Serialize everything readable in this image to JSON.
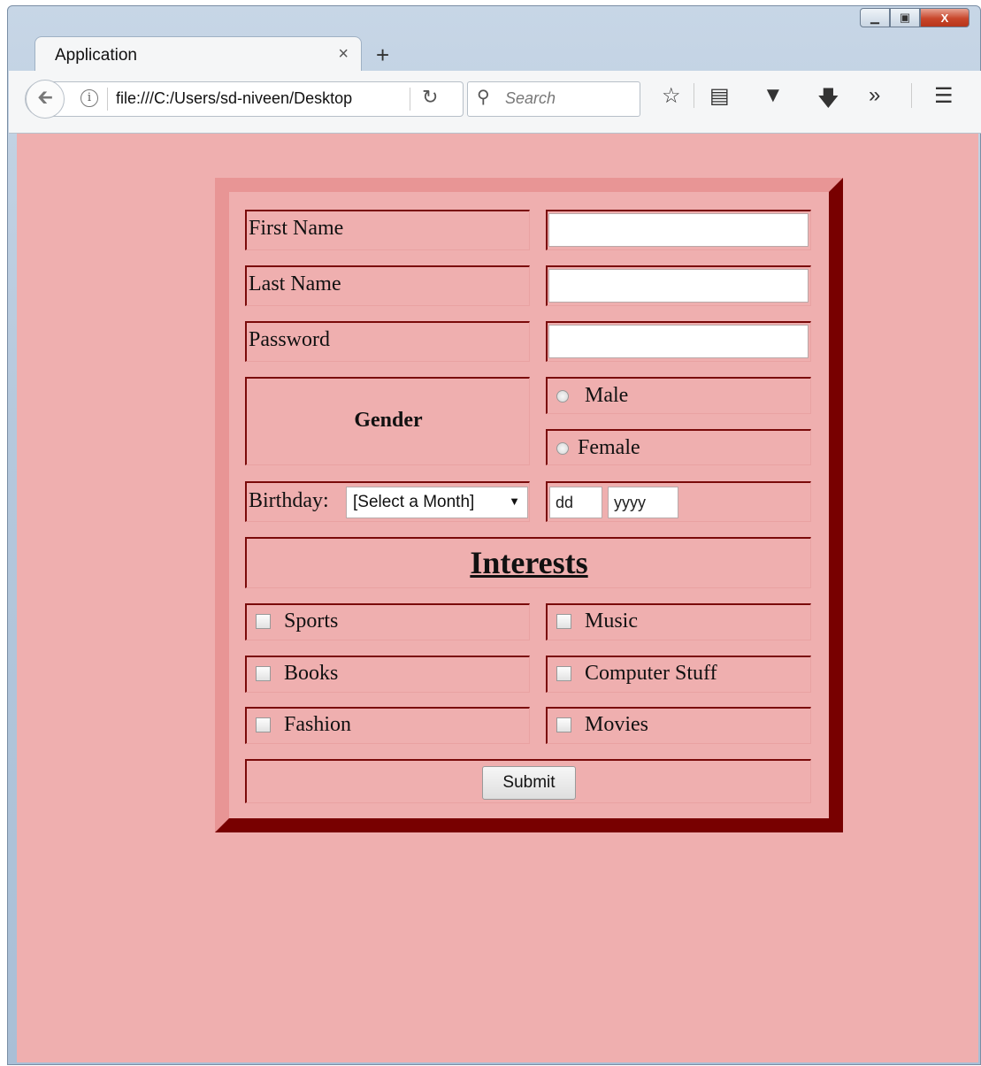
{
  "browser": {
    "tab_title": "Application",
    "tab_close": "×",
    "new_tab": "+",
    "url": "file:///C:/Users/sd-niveen/Desktop",
    "search_placeholder": "Search",
    "window_buttons": {
      "minimize": "▁",
      "maximize": "▣",
      "close": "X"
    },
    "toolbar_icons": [
      "star-icon",
      "reader-icon",
      "pocket-icon",
      "download-icon",
      "overflow-icon",
      "menu-icon"
    ]
  },
  "form": {
    "first_name_label": "First Name",
    "last_name_label": "Last Name",
    "password_label": "Password",
    "gender_label": "Gender",
    "gender_options": [
      "Male",
      "Female"
    ],
    "birthday_label": "Birthday:",
    "month_select": "[Select a Month]",
    "day_placeholder": "dd",
    "year_placeholder": "yyyy",
    "interests_title": "Interests",
    "interests": [
      "Sports",
      "Music",
      "Books",
      "Computer Stuff",
      "Fashion",
      "Movies"
    ],
    "submit_label": "Submit"
  },
  "colors": {
    "page_bg": "#efafaf",
    "border_dark": "#780000",
    "border_light": "#e89595"
  }
}
